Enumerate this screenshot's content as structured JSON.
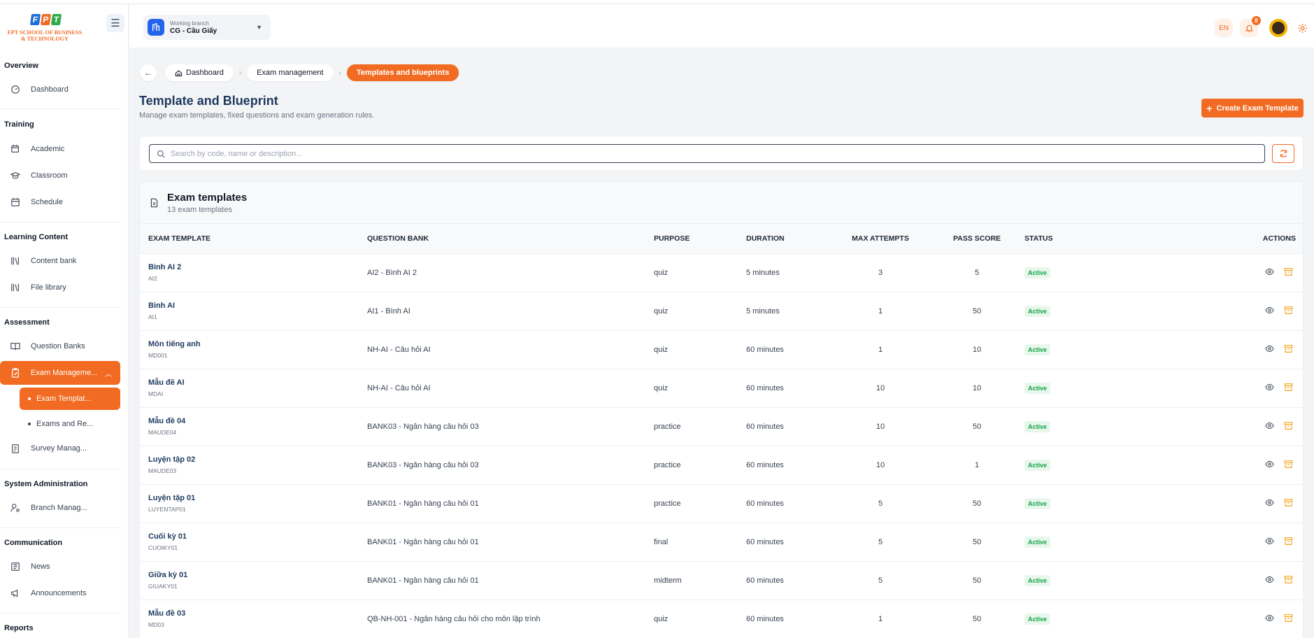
{
  "logo": {
    "mark": [
      "F",
      "P",
      "T"
    ],
    "line1": "FPT SCHOOL OF BUSINESS",
    "line2": "& TECHNOLOGY"
  },
  "sidebar": {
    "overview_title": "Overview",
    "dashboard": "Dashboard",
    "training_title": "Training",
    "academic": "Academic",
    "classroom": "Classroom",
    "schedule": "Schedule",
    "learning_title": "Learning Content",
    "content_bank": "Content bank",
    "file_library": "File library",
    "assessment_title": "Assessment",
    "question_banks": "Question Banks",
    "exam_management": "Exam Manageme...",
    "exam_templates": "Exam Templat...",
    "exams_results": "Exams and Re...",
    "survey": "Survey Manag...",
    "sysadmin_title": "System Administration",
    "branch_manage": "Branch Manag...",
    "comm_title": "Communication",
    "news": "News",
    "announcements": "Announcements",
    "reports_title": "Reports"
  },
  "header": {
    "branch_label": "Working branch",
    "branch_value": "CG - Cầu Giấy",
    "lang": "EN",
    "notif_count": "8"
  },
  "breadcrumb": [
    "Dashboard",
    "Exam management",
    "Templates and blueprints"
  ],
  "page": {
    "title": "Template and Blueprint",
    "subtitle": "Manage exam templates, fixed questions and exam generation rules.",
    "create_label": "Create Exam Template"
  },
  "search": {
    "placeholder": "Search by code, name or description...",
    "value": ""
  },
  "table": {
    "title": "Exam templates",
    "count": "13 exam templates",
    "columns": [
      "EXAM TEMPLATE",
      "QUESTION BANK",
      "PURPOSE",
      "DURATION",
      "MAX ATTEMPTS",
      "PASS SCORE",
      "STATUS",
      "ACTIONS"
    ],
    "rows": [
      {
        "name": "Bình AI 2",
        "code": "AI2",
        "bank": "AI2 - Bình AI 2",
        "purpose": "quiz",
        "duration": "5 minutes",
        "attempts": "3",
        "pass": "5",
        "status": "Active"
      },
      {
        "name": "Bình AI",
        "code": "AI1",
        "bank": "AI1 - Bình AI",
        "purpose": "quiz",
        "duration": "5 minutes",
        "attempts": "1",
        "pass": "50",
        "status": "Active"
      },
      {
        "name": "Môn tiếng anh",
        "code": "MD001",
        "bank": "NH-AI - Câu hỏi AI",
        "purpose": "quiz",
        "duration": "60 minutes",
        "attempts": "1",
        "pass": "10",
        "status": "Active"
      },
      {
        "name": "Mẫu đề AI",
        "code": "MDAI",
        "bank": "NH-AI - Câu hỏi AI",
        "purpose": "quiz",
        "duration": "60 minutes",
        "attempts": "10",
        "pass": "10",
        "status": "Active"
      },
      {
        "name": "Mẫu đề 04",
        "code": "MAUDE04",
        "bank": "BANK03 - Ngân hàng câu hỏi 03",
        "purpose": "practice",
        "duration": "60 minutes",
        "attempts": "10",
        "pass": "50",
        "status": "Active"
      },
      {
        "name": "Luyện tập 02",
        "code": "MAUDE03",
        "bank": "BANK03 - Ngân hàng câu hỏi 03",
        "purpose": "practice",
        "duration": "60 minutes",
        "attempts": "10",
        "pass": "1",
        "status": "Active"
      },
      {
        "name": "Luyện tập 01",
        "code": "LUYENTAP01",
        "bank": "BANK01 - Ngân hàng câu hỏi 01",
        "purpose": "practice",
        "duration": "60 minutes",
        "attempts": "5",
        "pass": "50",
        "status": "Active"
      },
      {
        "name": "Cuối kỳ 01",
        "code": "CUOIKY01",
        "bank": "BANK01 - Ngân hàng câu hỏi 01",
        "purpose": "final",
        "duration": "60 minutes",
        "attempts": "5",
        "pass": "50",
        "status": "Active"
      },
      {
        "name": "Giữa kỳ 01",
        "code": "GIUAKY01",
        "bank": "BANK01 - Ngân hàng câu hỏi 01",
        "purpose": "midterm",
        "duration": "60 minutes",
        "attempts": "5",
        "pass": "50",
        "status": "Active"
      },
      {
        "name": "Mẫu đề 03",
        "code": "MD03",
        "bank": "QB-NH-001 - Ngân hàng câu hỏi cho môn lập trình",
        "purpose": "quiz",
        "duration": "60 minutes",
        "attempts": "1",
        "pass": "50",
        "status": "Active"
      }
    ]
  },
  "colors": {
    "accent": "#f26b22",
    "title": "#1e3a5f",
    "active_green": "#16a34a",
    "branch_blue": "#2563eb"
  }
}
